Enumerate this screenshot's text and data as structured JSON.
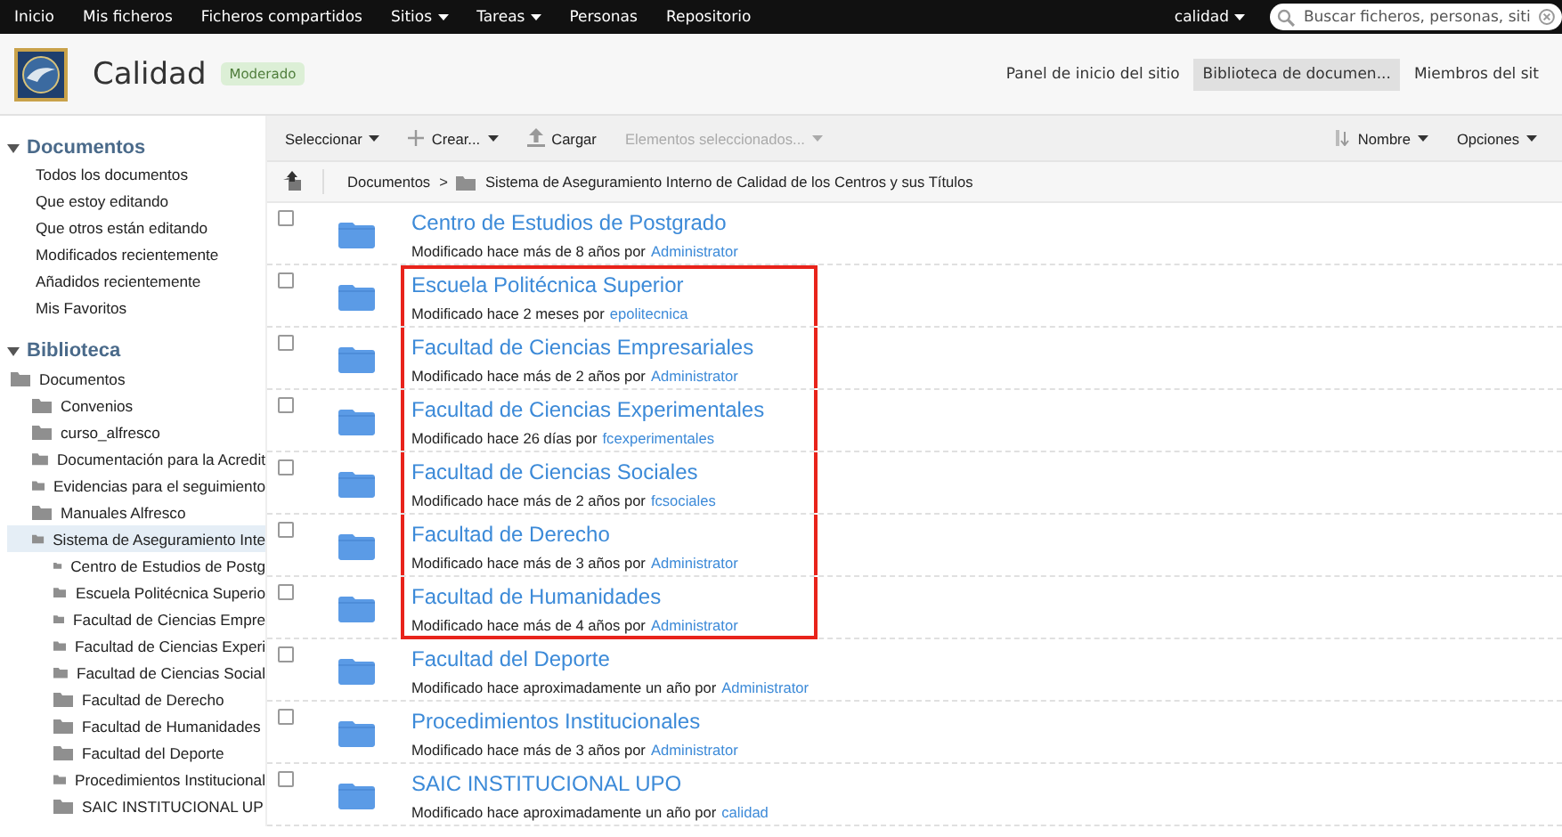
{
  "top_bar": {
    "items": [
      {
        "label": "Inicio",
        "dropdown": false
      },
      {
        "label": "Mis ficheros",
        "dropdown": false
      },
      {
        "label": "Ficheros compartidos",
        "dropdown": false
      },
      {
        "label": "Sitios",
        "dropdown": true
      },
      {
        "label": "Tareas",
        "dropdown": true
      },
      {
        "label": "Personas",
        "dropdown": false
      },
      {
        "label": "Repositorio",
        "dropdown": false
      }
    ],
    "user": {
      "label": "calidad",
      "dropdown": true
    },
    "search": {
      "placeholder": "Buscar ficheros, personas, siti"
    }
  },
  "site_header": {
    "title": "Calidad",
    "badge": "Moderado",
    "nav": [
      {
        "label": "Panel de inicio del sitio",
        "selected": false
      },
      {
        "label": "Biblioteca de documen...",
        "selected": true
      },
      {
        "label": "Miembros del sit",
        "selected": false
      }
    ]
  },
  "sidebar": {
    "filters": {
      "title": "Documentos",
      "expanded": true,
      "items": [
        "Todos los documentos",
        "Que estoy editando",
        "Que otros están editando",
        "Modificados recientemente",
        "Añadidos recientemente",
        "Mis Favoritos"
      ]
    },
    "library": {
      "title": "Biblioteca",
      "expanded": true,
      "tree": [
        {
          "label": "Documentos",
          "selected": false,
          "children": [
            {
              "label": "Convenios",
              "selected": false
            },
            {
              "label": "curso_alfresco",
              "selected": false
            },
            {
              "label": "Documentación para la Acredit",
              "selected": false
            },
            {
              "label": "Evidencias para el seguimiento",
              "selected": false
            },
            {
              "label": "Manuales Alfresco",
              "selected": false
            },
            {
              "label": "Sistema de Aseguramiento Inte",
              "selected": true,
              "children": [
                {
                  "label": "Centro de Estudios de Postg",
                  "selected": false
                },
                {
                  "label": "Escuela Politécnica Superio",
                  "selected": false
                },
                {
                  "label": "Facultad de Ciencias Empre",
                  "selected": false
                },
                {
                  "label": "Facultad de Ciencias Experi",
                  "selected": false
                },
                {
                  "label": "Facultad de Ciencias Social",
                  "selected": false
                },
                {
                  "label": "Facultad de Derecho",
                  "selected": false
                },
                {
                  "label": "Facultad de Humanidades",
                  "selected": false
                },
                {
                  "label": "Facultad del Deporte",
                  "selected": false
                },
                {
                  "label": "Procedimientos Institucional",
                  "selected": false
                },
                {
                  "label": "SAIC INSTITUCIONAL UP",
                  "selected": false
                }
              ]
            }
          ]
        }
      ]
    }
  },
  "toolbar": {
    "buttons": [
      {
        "label": "Seleccionar",
        "kind": "dropdown",
        "disabled": false
      },
      {
        "label": "Crear...",
        "kind": "create",
        "disabled": false
      },
      {
        "label": "Cargar",
        "kind": "upload",
        "disabled": false
      },
      {
        "label": "Elementos seleccionados...",
        "kind": "dropdown",
        "disabled": true
      }
    ],
    "sort": {
      "label": "Nombre"
    },
    "options": {
      "label": "Opciones"
    }
  },
  "breadcrumb": {
    "root": "Documentos",
    "separator": ">",
    "folder": "Sistema de Aseguramiento Interno de Calidad de los Centros y sus Títulos"
  },
  "rows": [
    {
      "name": "Centro de Estudios de Postgrado",
      "modified": "Modificado hace más de 8 años por",
      "user": "Administrator",
      "checked": false,
      "highlighted": false
    },
    {
      "name": "Escuela Politécnica Superior",
      "modified": "Modificado hace 2 meses por",
      "user": "epolitecnica",
      "checked": false,
      "highlighted": true
    },
    {
      "name": "Facultad de Ciencias Empresariales",
      "modified": "Modificado hace más de 2 años por",
      "user": "Administrator",
      "checked": false,
      "highlighted": true
    },
    {
      "name": "Facultad de Ciencias Experimentales",
      "modified": "Modificado hace 26 días por",
      "user": "fcexperimentales",
      "checked": false,
      "highlighted": true
    },
    {
      "name": "Facultad de Ciencias Sociales",
      "modified": "Modificado hace más de 2 años por",
      "user": "fcsociales",
      "checked": false,
      "highlighted": true
    },
    {
      "name": "Facultad de Derecho",
      "modified": "Modificado hace más de 3 años por",
      "user": "Administrator",
      "checked": false,
      "highlighted": true
    },
    {
      "name": "Facultad de Humanidades",
      "modified": "Modificado hace más de 4 años por",
      "user": "Administrator",
      "checked": false,
      "highlighted": true
    },
    {
      "name": "Facultad del Deporte",
      "modified": "Modificado hace aproximadamente un año por",
      "user": "Administrator",
      "checked": false,
      "highlighted": false
    },
    {
      "name": "Procedimientos Institucionales",
      "modified": "Modificado hace más de 3 años por",
      "user": "Administrator",
      "checked": false,
      "highlighted": false
    },
    {
      "name": "SAIC INSTITUCIONAL UPO",
      "modified": "Modificado hace aproximadamente un año por",
      "user": "calidad",
      "checked": false,
      "highlighted": false
    }
  ]
}
